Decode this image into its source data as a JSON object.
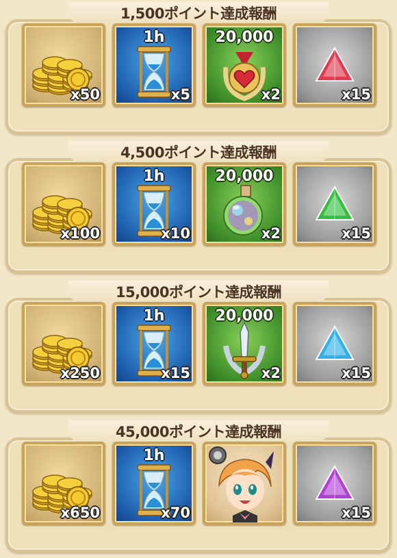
{
  "sections": [
    {
      "title": "1,500ポイント達成報酬",
      "items": [
        {
          "icon": "gold-coins-icon",
          "quantity": "x50"
        },
        {
          "icon": "hourglass-icon",
          "label": "1h",
          "quantity": "x5"
        },
        {
          "icon": "heart-medal-icon",
          "label": "20,000",
          "quantity": "x2"
        },
        {
          "icon": "red-gem-icon",
          "quantity": "x15",
          "color": "#e0364a"
        }
      ]
    },
    {
      "title": "4,500ポイント達成報酬",
      "items": [
        {
          "icon": "gold-coins-icon",
          "quantity": "x100"
        },
        {
          "icon": "hourglass-icon",
          "label": "1h",
          "quantity": "x10"
        },
        {
          "icon": "potion-flask-icon",
          "label": "20,000",
          "quantity": "x2"
        },
        {
          "icon": "green-gem-icon",
          "quantity": "x15",
          "color": "#2fbf3a"
        }
      ]
    },
    {
      "title": "15,000ポイント達成報酬",
      "items": [
        {
          "icon": "gold-coins-icon",
          "quantity": "x250"
        },
        {
          "icon": "hourglass-icon",
          "label": "1h",
          "quantity": "x15"
        },
        {
          "icon": "sword-emblem-icon",
          "label": "20,000",
          "quantity": "x2"
        },
        {
          "icon": "blue-gem-icon",
          "quantity": "x15",
          "color": "#2ab0e8"
        }
      ]
    },
    {
      "title": "45,000ポイント達成報酬",
      "items": [
        {
          "icon": "gold-coins-icon",
          "quantity": "x650"
        },
        {
          "icon": "hourglass-icon",
          "label": "1h",
          "quantity": "x70"
        },
        {
          "icon": "character-portrait-icon"
        },
        {
          "icon": "purple-gem-icon",
          "quantity": "x15",
          "color": "#b13ad6"
        }
      ]
    }
  ]
}
